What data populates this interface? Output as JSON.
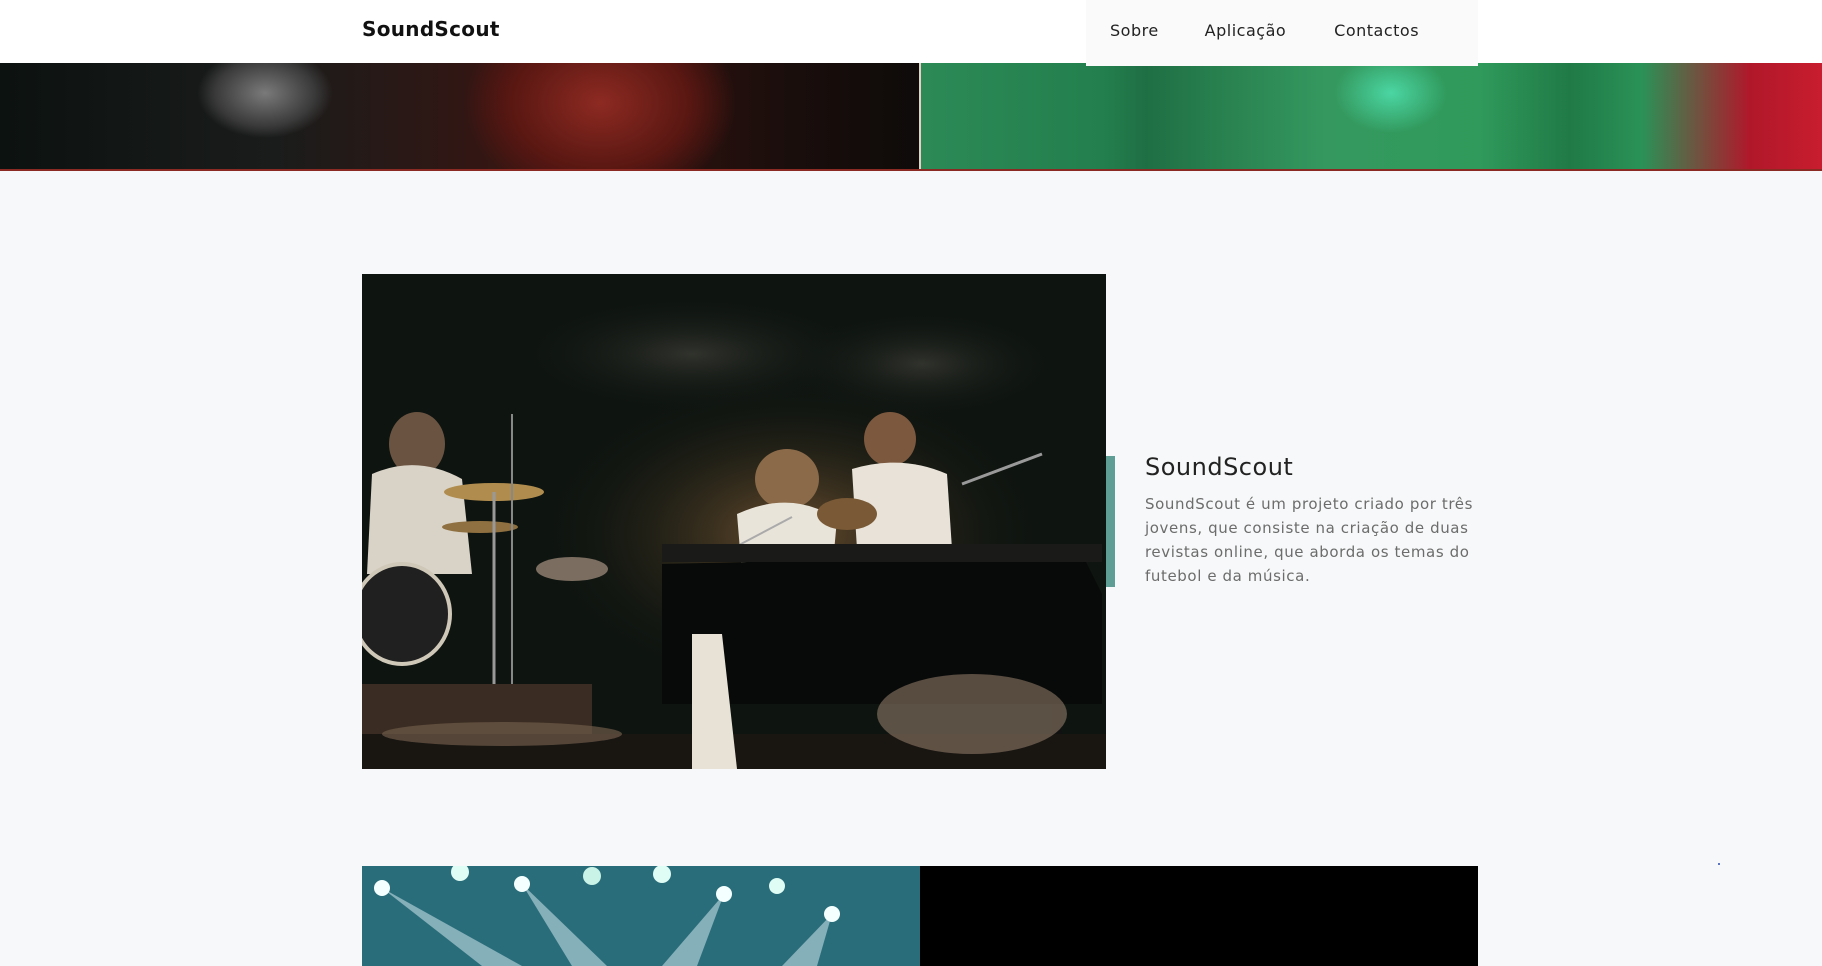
{
  "navbar": {
    "brand": "SoundScout",
    "links": [
      "Sobre",
      "Aplicação",
      "Contactos"
    ]
  },
  "about": {
    "title": "SoundScout",
    "text": "SoundScout é um projeto criado por três jovens, que consiste na criação de duas revistas online, que aborda os temas do futebol e da música."
  },
  "colors": {
    "accent": "#5f9e94",
    "background": "#f7f8f9",
    "hero_border": "#8a2a22"
  }
}
